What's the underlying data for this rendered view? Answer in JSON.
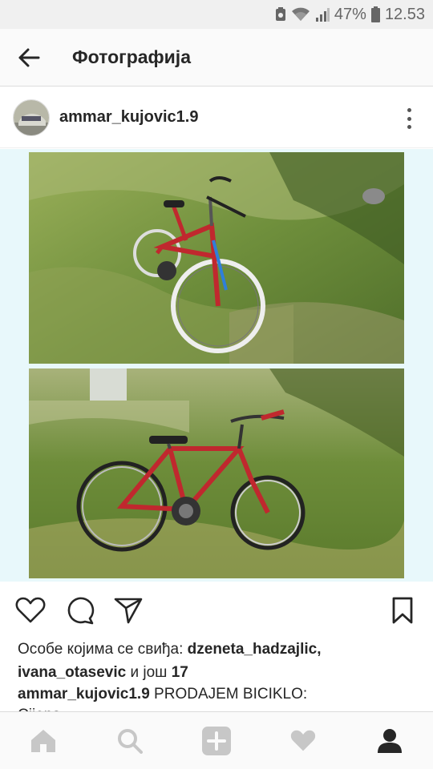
{
  "status_bar": {
    "battery": "47%",
    "time": "12.53",
    "icons": [
      "notification-icon",
      "wifi-icon",
      "signal-icon",
      "battery-icon"
    ]
  },
  "app_bar": {
    "title": "Фотографија",
    "back_icon": "arrow-left-icon"
  },
  "post": {
    "username": "ammar_kujovic1.9",
    "likes": {
      "prefix": "Особе којима се свиђа: ",
      "user1": "dzeneta_hadzajlic,",
      "user2": "ivana_otasevic",
      "middle": " и још ",
      "count": "17"
    },
    "caption": {
      "username": "ammar_kujovic1.9",
      "text": " PRODAJEM BICIKLO:",
      "partial": "Cijena..."
    }
  },
  "actions": [
    "heart-icon",
    "comment-icon",
    "share-icon",
    "bookmark-icon"
  ],
  "bottom_nav": [
    "home-icon",
    "search-icon",
    "add-icon",
    "activity-icon",
    "profile-icon"
  ],
  "colors": {
    "grass": "#6f8f3c",
    "bike": "#c0282e",
    "photo_bg": "#e8f8fb",
    "icon_gray": "#c7c7c7"
  }
}
